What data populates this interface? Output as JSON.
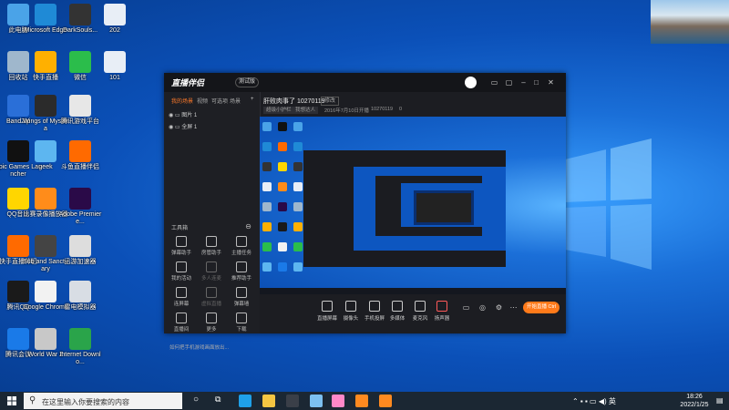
{
  "desktop_icons": [
    {
      "label": "此电脑",
      "color": "#4aa3e8"
    },
    {
      "label": "Microsoft Edge",
      "color": "#1f8ad6"
    },
    {
      "label": "DarkSouls...",
      "color": "#333333"
    },
    {
      "label": "202",
      "color": "#e8eef6"
    },
    {
      "label": "回收站",
      "color": "#9fb7cc"
    },
    {
      "label": "快手直播",
      "color": "#ffb000"
    },
    {
      "label": "微信",
      "color": "#2bbd4b"
    },
    {
      "label": "101",
      "color": "#e8eef6"
    },
    {
      "label": "BandZip",
      "color": "#2a6fd8"
    },
    {
      "label": "Wings of Mystiria",
      "color": "#2b2b2b"
    },
    {
      "label": "腾讯游戏平台",
      "color": "#e7e7e7"
    },
    {
      "label": "Epic Games Launcher",
      "color": "#111111"
    },
    {
      "label": "geek",
      "color": "#5db6f0"
    },
    {
      "label": "斗鱼直播伴侣",
      "color": "#ff6a00"
    },
    {
      "label": "QQ音乐",
      "color": "#ffd600"
    },
    {
      "label": "比赛录像播放器",
      "color": "#ff8c1a"
    },
    {
      "label": "Adobe Premiere...",
      "color": "#2a0a48"
    },
    {
      "label": "快手直播伴侣",
      "color": "#ff6a00"
    },
    {
      "label": "Sub and Sanctuary",
      "color": "#444444"
    },
    {
      "label": "迅游加速器",
      "color": "#dddddd"
    },
    {
      "label": "腾讯QQ",
      "color": "#1a1a1a"
    },
    {
      "label": "Google Chrome",
      "color": "#f2f2f2"
    },
    {
      "label": "雷电模拟器",
      "color": "#d8dde4"
    },
    {
      "label": "腾讯会议",
      "color": "#1a7ae8"
    },
    {
      "label": "World War Z",
      "color": "#c8c8c8"
    },
    {
      "label": "Internet Downlo...",
      "color": "#2aa44a"
    }
  ],
  "app": {
    "logo": "直播伴侣",
    "version_badge": "测试版",
    "tabs": [
      "我的场景",
      "视频",
      "可选项",
      "场景"
    ],
    "scenes": [
      "图片 1",
      "全屏 1"
    ],
    "toolbox_title": "工具箱",
    "tools": [
      {
        "label": "弹幕助手"
      },
      {
        "label": "房管助手"
      },
      {
        "label": "主播任务"
      },
      {
        "label": "我的活动"
      },
      {
        "label": "多人连麦"
      },
      {
        "label": "推荐助手"
      },
      {
        "label": "连屏幕"
      },
      {
        "label": "虚拟直播"
      },
      {
        "label": "弹幕墙"
      },
      {
        "label": "直播间"
      },
      {
        "label": "更多"
      },
      {
        "label": "下载"
      }
    ],
    "notice": "如何把手机游戏画面放出...",
    "stream_title": "肝败肉事了 10270119",
    "stream_badge": "修改",
    "meta": [
      "超级小护栏",
      "我想达人",
      "2016年7月10日开播",
      "10270119",
      "0"
    ],
    "bottom_buttons": [
      {
        "label": "直播屏幕"
      },
      {
        "label": "摄像头"
      },
      {
        "label": "手机投屏"
      },
      {
        "label": "多媒体"
      },
      {
        "label": "麦克风"
      },
      {
        "label": "扬声器"
      }
    ],
    "start_live": "开始直播 Ctrl"
  },
  "taskbar": {
    "search_placeholder": "在这里输入你要搜索的内容",
    "ime": "英",
    "time": "18:26",
    "date": "2022/1/25"
  }
}
